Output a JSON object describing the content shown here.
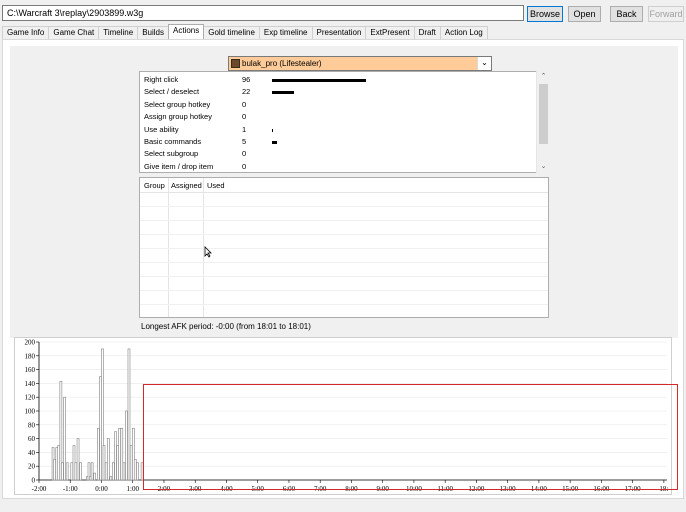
{
  "toolbar": {
    "path_value": "C:\\Warcraft 3\\replay\\2903899.w3g",
    "browse_label": "Browse",
    "open_label": "Open",
    "back_label": "Back",
    "forward_label": "Forward"
  },
  "tabs": [
    {
      "label": "Game Info"
    },
    {
      "label": "Game Chat"
    },
    {
      "label": "Timeline"
    },
    {
      "label": "Builds"
    },
    {
      "label": "Actions"
    },
    {
      "label": "Gold timeline"
    },
    {
      "label": "Exp timeline"
    },
    {
      "label": "Presentation"
    },
    {
      "label": "ExtPresent"
    },
    {
      "label": "Draft"
    },
    {
      "label": "Action Log"
    }
  ],
  "active_tab": "Actions",
  "player_select": {
    "value": "bulak_pro (Lifestealer)",
    "background": "#ffcc99"
  },
  "actions": [
    {
      "label": "Right click",
      "count": "96"
    },
    {
      "label": "Select / deselect",
      "count": "22"
    },
    {
      "label": "Select group hotkey",
      "count": "0"
    },
    {
      "label": "Assign group hotkey",
      "count": "0"
    },
    {
      "label": "Use ability",
      "count": "1"
    },
    {
      "label": "Basic commands",
      "count": "5"
    },
    {
      "label": "Select subgroup",
      "count": "0"
    },
    {
      "label": "Give item / drop item",
      "count": "0"
    }
  ],
  "group_table": {
    "headers": [
      "Group",
      "Assigned",
      "Used"
    ],
    "rows": []
  },
  "afk_text": "Longest AFK period: -0:00 (from 18:01 to 18:01)",
  "chart_data": {
    "type": "bar",
    "title": "",
    "xlabel": "",
    "ylabel": "",
    "ylim": [
      0,
      200
    ],
    "yticks": [
      "0",
      "20",
      "40",
      "60",
      "80",
      "100",
      "120",
      "140",
      "160",
      "180",
      "200"
    ],
    "xlim": [
      -2,
      18.1
    ],
    "xticks": [
      "-2:00",
      "-1:00",
      "0:00",
      "1:00",
      "2:00",
      "3:00",
      "4:00",
      "5:00",
      "6:00",
      "7:00",
      "8:00",
      "9:00",
      "10:00",
      "11:00",
      "12:00",
      "13:00",
      "14:00",
      "15:00",
      "16:00",
      "17:00",
      "18:"
    ],
    "xtick_values": [
      -2,
      -1,
      0,
      1,
      2,
      3,
      4,
      5,
      6,
      7,
      8,
      9,
      10,
      11,
      12,
      13,
      14,
      15,
      16,
      17,
      18
    ],
    "x": [
      -1.55,
      -1.5,
      -1.43,
      -1.37,
      -1.3,
      -1.25,
      -1.18,
      -1.1,
      -0.95,
      -0.88,
      -0.82,
      -0.75,
      -0.67,
      -0.45,
      -0.4,
      -0.35,
      -0.3,
      -0.22,
      -0.1,
      -0.03,
      0.03,
      0.08,
      0.15,
      0.22,
      0.3,
      0.38,
      0.45,
      0.52,
      0.58,
      0.65,
      0.72,
      0.8,
      0.88,
      0.95,
      1.02,
      1.08,
      1.15,
      1.3
    ],
    "values": [
      47,
      30,
      47,
      50,
      143,
      25,
      120,
      25,
      25,
      50,
      25,
      60,
      25,
      5,
      25,
      5,
      25,
      10,
      75,
      150,
      190,
      50,
      25,
      60,
      5,
      25,
      70,
      50,
      75,
      75,
      25,
      100,
      190,
      50,
      75,
      30,
      25,
      25
    ],
    "series_color": "#808080"
  },
  "highlight_color": "#d62828"
}
